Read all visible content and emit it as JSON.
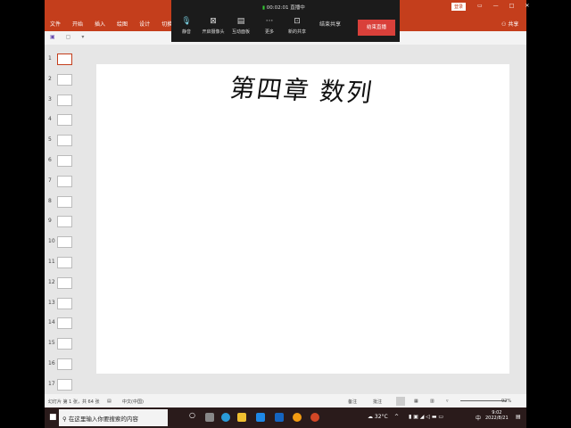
{
  "ribbon": {
    "tabs": [
      "文件",
      "开始",
      "插入",
      "绘图",
      "设计",
      "切换"
    ],
    "login": "登录",
    "share": "共享",
    "window_controls": [
      "▭",
      "—",
      "□",
      "✕"
    ]
  },
  "meeting": {
    "timer": "00:02:01",
    "status": "直播中",
    "buttons": [
      {
        "label": "静音",
        "icon": "microphone-icon"
      },
      {
        "label": "开启摄像头",
        "icon": "camera-off-icon"
      },
      {
        "label": "互动面板",
        "icon": "panel-icon"
      },
      {
        "label": "更多",
        "icon": "more-icon"
      },
      {
        "label": "新的共享",
        "icon": "share-screen-icon"
      }
    ],
    "end_share": "结束共享",
    "end_meeting": "结束直播"
  },
  "thumbnails": [
    "1",
    "2",
    "3",
    "4",
    "5",
    "6",
    "7",
    "8",
    "9",
    "10",
    "11",
    "12",
    "13",
    "14",
    "15",
    "16",
    "17"
  ],
  "slide": {
    "title": "第四章 数列"
  },
  "status": {
    "slide_info": "幻灯片 第 1 张，共 64 张",
    "language": "中文(中国)",
    "notes": "备注",
    "comments": "批注",
    "zoom": "92%"
  },
  "taskbar": {
    "search_placeholder": "在这里输入你要搜索的内容",
    "weather": "32°C",
    "ime": "中",
    "time": "9:02",
    "date": "2022/8/21"
  }
}
